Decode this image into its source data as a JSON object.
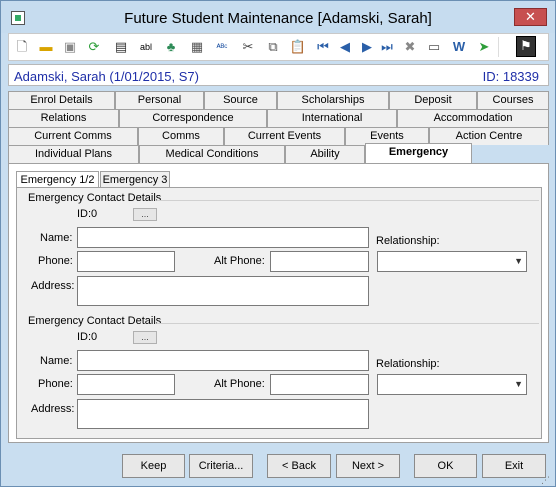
{
  "window": {
    "title": "Future Student Maintenance  [Adamski, Sarah]",
    "close_label": "✕"
  },
  "toolbar": {
    "icons": [
      "new-icon",
      "open-icon",
      "save-icon",
      "refresh-icon",
      "print-icon",
      "abl-icon",
      "tree-icon",
      "calculator-icon",
      "spellcheck-icon",
      "cut-icon",
      "copy-icon",
      "paste-icon",
      "first-record-icon",
      "previous-record-icon",
      "next-record-icon",
      "last-record-icon",
      "delete-icon",
      "card-icon",
      "word-icon",
      "arrow-icon",
      "flag-icon"
    ]
  },
  "header": {
    "student": "Adamski, Sarah (1/01/2015, S7)",
    "id": "ID: 18339"
  },
  "tabs": {
    "row1": [
      "Enrol Details",
      "Personal",
      "Source",
      "Scholarships",
      "Deposit",
      "Courses"
    ],
    "row2": [
      "Relations",
      "Correspondence",
      "International",
      "Accommodation"
    ],
    "row3": [
      "Current Comms",
      "Comms",
      "Current Events",
      "Events",
      "Action Centre"
    ],
    "row4": [
      "Individual Plans",
      "Medical Conditions",
      "Ability",
      "Emergency"
    ]
  },
  "subtabs": [
    "Emergency 1/2",
    "Emergency 3"
  ],
  "contacts": [
    {
      "group_title": "Emergency Contact Details",
      "id_label": "ID:0",
      "dots": "...",
      "name_label": "Name:",
      "name_value": "",
      "phone_label": "Phone:",
      "phone_value": "",
      "alt_phone_label": "Alt Phone:",
      "alt_phone_value": "",
      "address_label": "Address:",
      "address_value": "",
      "relationship_label": "Relationship:",
      "relationship_value": ""
    },
    {
      "group_title": "Emergency Contact Details",
      "id_label": "ID:0",
      "dots": "...",
      "name_label": "Name:",
      "name_value": "",
      "phone_label": "Phone:",
      "phone_value": "",
      "alt_phone_label": "Alt Phone:",
      "alt_phone_value": "",
      "address_label": "Address:",
      "address_value": "",
      "relationship_label": "Relationship:",
      "relationship_value": ""
    }
  ],
  "buttons": {
    "keep": "Keep",
    "criteria": "Criteria...",
    "back": "< Back",
    "next": "Next >",
    "ok": "OK",
    "exit": "Exit"
  }
}
